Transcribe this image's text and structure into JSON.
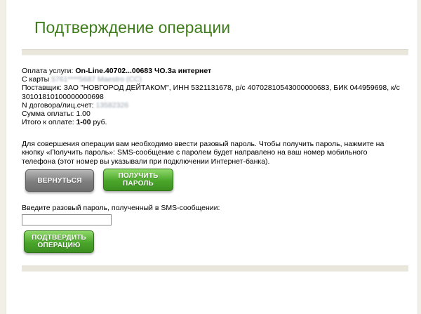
{
  "page": {
    "title": "Подтверждение операции"
  },
  "payment": {
    "service_label": "Оплата услуги:",
    "service_value": "On-Line.40702...00683 ЧО.За интернет",
    "card_label": "С карты",
    "card_value": "5761****5687 Maestro (СС)",
    "supplier_line1": "Поставщик: ЗАО \"НОВГОРОД ДЕЙТАКОМ\", ИНН 5321131678, р/с 40702810543000000683, БИК 044959698, к/с",
    "supplier_line2": "30101810100000000698",
    "contract_label": "N договора/лиц.счет:",
    "contract_value": "13582326",
    "amount_line": "Сумма оплаты: 1.00",
    "total_label": "Итого к оплате:",
    "total_value": "1-00",
    "total_currency": "руб."
  },
  "notice": {
    "text": "Для совершения операции вам необходимо ввести разовый пароль. Чтобы получить пароль, нажмите на кнопку «Получить пароль»: SMS-сообщение с паролем будет направлено на ваш номер мобильного телефона (этот номер вы указывали при подключении Интернет-банка)."
  },
  "buttons": {
    "back_label": "ВЕРНУТЬСЯ",
    "get_password_line1": "ПОЛУЧИТЬ",
    "get_password_line2": "ПАРОЛЬ",
    "confirm_line1": "ПОДТВЕРДИТЬ",
    "confirm_line2": "ОПЕРАЦИЮ"
  },
  "password": {
    "label": "Введите разовый пароль, полученный в SMS-сообщении:",
    "value": ""
  },
  "colors": {
    "title_green": "#3f7d1c",
    "button_green": "#4aa62a",
    "button_gray": "#7f7f7f"
  }
}
